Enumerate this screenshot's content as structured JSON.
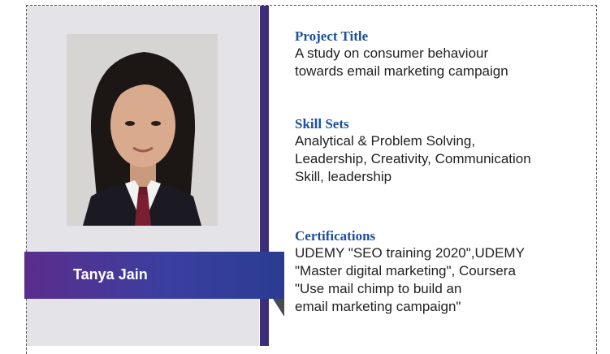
{
  "profile": {
    "name": "Tanya Jain",
    "photo_icon": "person-photo"
  },
  "sections": {
    "project": {
      "heading": "Project Title",
      "lines": [
        "A study on consumer behaviour",
        "towards email marketing campaign"
      ]
    },
    "skills": {
      "heading": "Skill Sets",
      "lines": [
        "Analytical & Problem Solving,",
        "Leadership, Creativity, Communication",
        "Skill, leadership"
      ]
    },
    "certifications": {
      "heading": "Certifications",
      "lines": [
        "UDEMY \"SEO training 2020\",UDEMY",
        "\"Master digital marketing\", Coursera",
        "\"Use mail chimp to build an",
        "email marketing campaign\""
      ]
    }
  },
  "colors": {
    "heading": "#1d4f9e",
    "divider": "#3d2e7c",
    "banner_start": "#5a2d8c",
    "banner_end": "#2a3c92",
    "panel": "#e4e3e8"
  }
}
